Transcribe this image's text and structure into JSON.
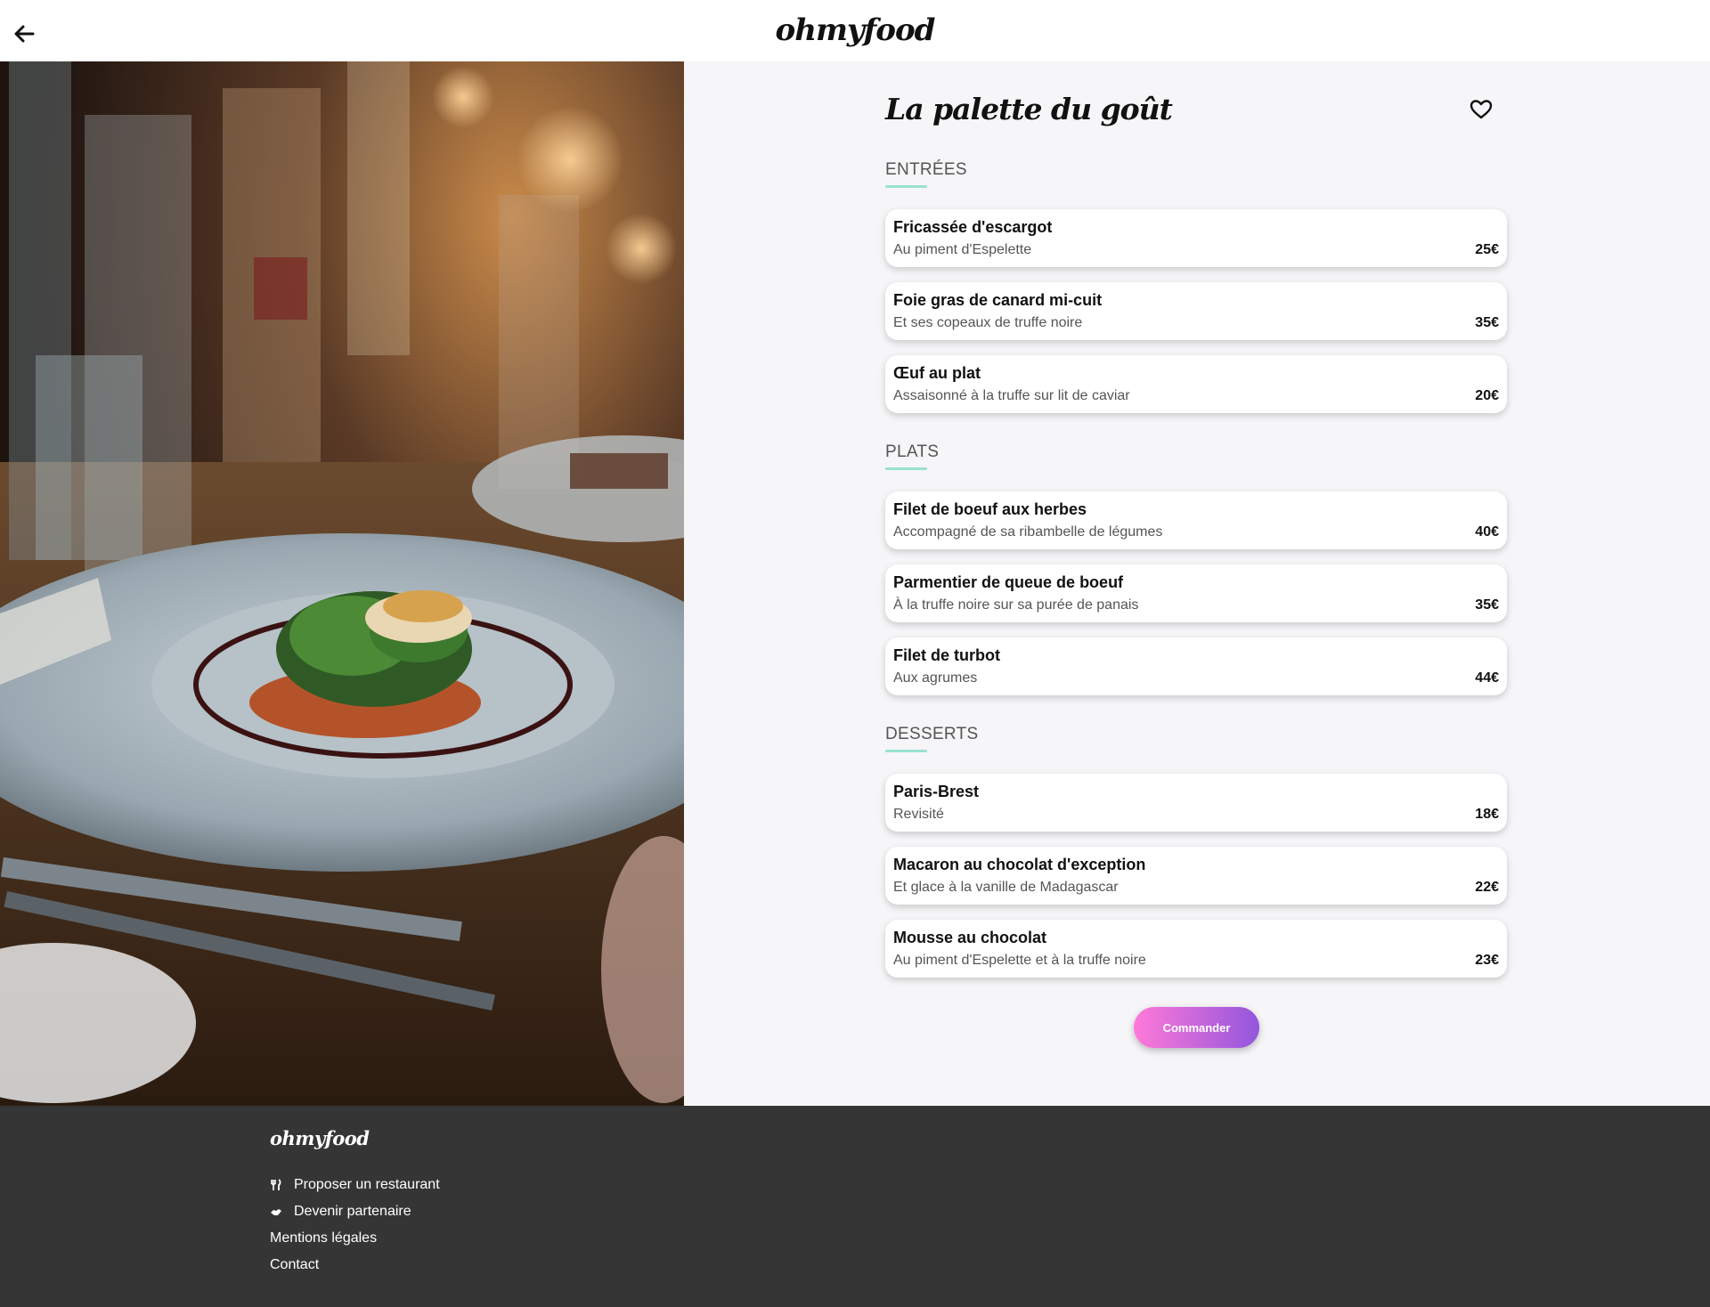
{
  "header": {
    "logo": "ohmyfood",
    "back_icon": "arrow-left-icon"
  },
  "hero": {
    "image": "restaurant-dish-photo"
  },
  "menu": {
    "title": "La palette du goût",
    "favorite_icon": "heart-outline-icon",
    "sections": [
      {
        "heading": "ENTRÉES",
        "dishes": [
          {
            "name": "Fricassée d'escargot",
            "desc": "Au piment d'Espelette",
            "price": "25€"
          },
          {
            "name": "Foie gras de canard mi-cuit",
            "desc": "Et ses copeaux de truffe noire",
            "price": "35€"
          },
          {
            "name": "Œuf au plat",
            "desc": "Assaisonné à la truffe sur lit de caviar",
            "price": "20€"
          }
        ]
      },
      {
        "heading": "PLATS",
        "dishes": [
          {
            "name": "Filet de boeuf aux herbes",
            "desc": "Accompagné de sa ribambelle de légumes",
            "price": "40€"
          },
          {
            "name": "Parmentier de queue de boeuf",
            "desc": "À la truffe noire sur sa purée de panais",
            "price": "35€"
          },
          {
            "name": "Filet de turbot",
            "desc": "Aux agrumes",
            "price": "44€"
          }
        ]
      },
      {
        "heading": "DESSERTS",
        "dishes": [
          {
            "name": "Paris-Brest",
            "desc": "Revisité",
            "price": "18€"
          },
          {
            "name": "Macaron au chocolat d'exception",
            "desc": "Et glace à la vanille de Madagascar",
            "price": "22€"
          },
          {
            "name": "Mousse au chocolat",
            "desc": "Au piment d'Espelette et à la truffe noire",
            "price": "23€"
          }
        ]
      }
    ],
    "order_button": "Commander",
    "accent_color": "#99e2d0",
    "button_gradient": [
      "#ff79da",
      "#9356dc"
    ]
  },
  "footer": {
    "logo": "ohmyfood",
    "links": [
      {
        "label": "Proposer un restaurant",
        "icon": "utensils-icon"
      },
      {
        "label": "Devenir partenaire",
        "icon": "handshake-icon"
      },
      {
        "label": "Mentions légales"
      },
      {
        "label": "Contact"
      }
    ]
  }
}
